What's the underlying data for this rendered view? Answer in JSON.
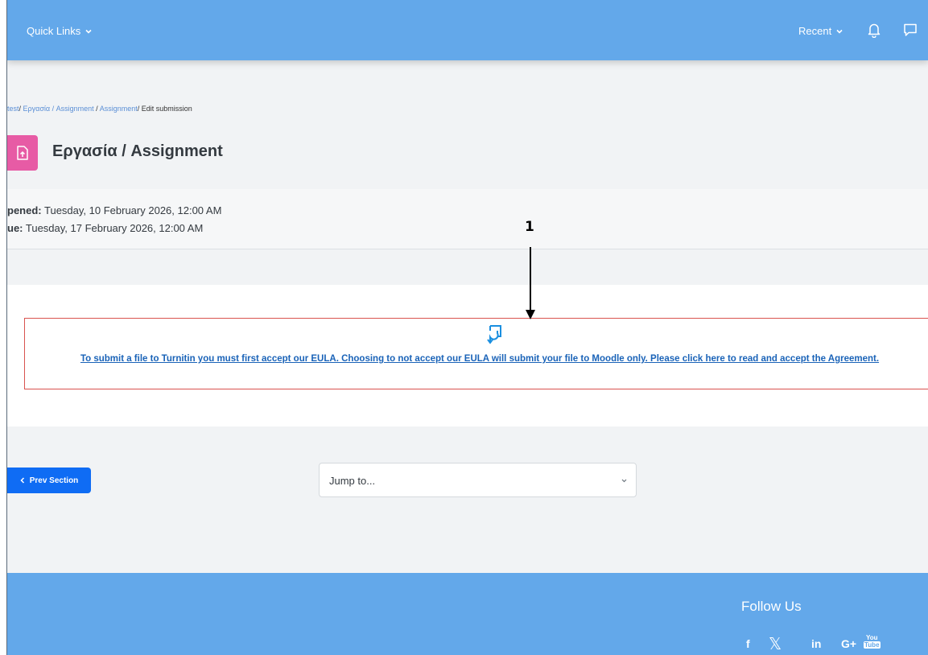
{
  "navbar": {
    "quick_links_label": "Quick Links",
    "recent_label": "Recent",
    "icons": [
      "bell-icon",
      "chat-icon",
      "chevron-down-icon"
    ],
    "background": "#63a8ea"
  },
  "breadcrumb": {
    "items": [
      "test",
      "Εργασία / Assignment",
      "Assignment",
      "Edit submission"
    ],
    "separator": "/"
  },
  "page": {
    "title": "Εργασία / Assignment",
    "icon": "assignment-upload-icon",
    "icon_color": "#e75ba5"
  },
  "dates": {
    "opened_label": "pened:",
    "opened_value": "Tuesday, 10 February 2026, 12:00 AM",
    "due_label": "ue:",
    "due_value": "Tuesday, 17 February 2026, 12:00 AM"
  },
  "eula": {
    "icon": "turnitin-eula-icon",
    "link_text": "To submit a file to Turnitin you must first accept our EULA. Choosing to not accept our EULA will submit your file to Moodle only. Please click here to read and accept the Agreement.",
    "border_color": "#d9534f",
    "link_color": "#1a63b8"
  },
  "annotation": {
    "label": "1"
  },
  "navigation": {
    "prev_label": "Prev Section",
    "jump_placeholder": "Jump to..."
  },
  "footer": {
    "follow_label": "Follow Us",
    "social": {
      "facebook": "f",
      "x": "𝕏",
      "linkedin": "in",
      "google_plus": "G+",
      "youtube_top": "You",
      "youtube_bottom": "Tube"
    }
  }
}
